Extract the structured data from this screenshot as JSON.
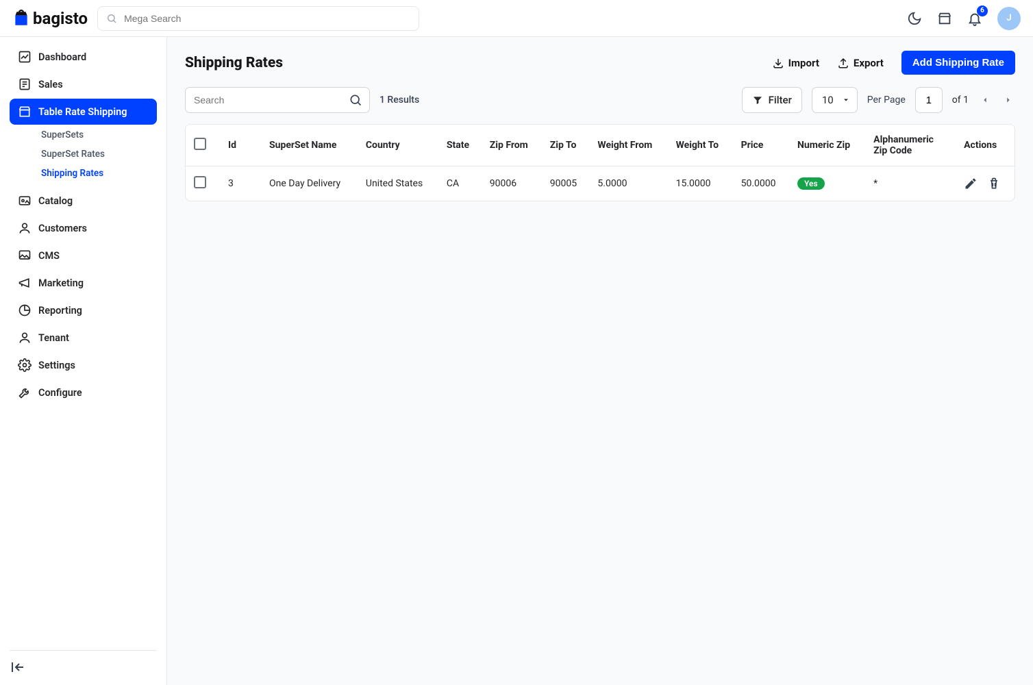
{
  "brand": "bagisto",
  "search": {
    "placeholder": "Mega Search"
  },
  "notifications": {
    "count": "6"
  },
  "avatar": {
    "initial": "J"
  },
  "nav": {
    "dashboard": "Dashboard",
    "sales": "Sales",
    "table_rate": "Table Rate Shipping",
    "sub": {
      "supersets": "SuperSets",
      "superset_rates": "SuperSet Rates",
      "shipping_rates": "Shipping Rates"
    },
    "catalog": "Catalog",
    "customers": "Customers",
    "cms": "CMS",
    "marketing": "Marketing",
    "reporting": "Reporting",
    "tenant": "Tenant",
    "settings": "Settings",
    "configure": "Configure"
  },
  "page": {
    "title": "Shipping Rates",
    "import": "Import",
    "export": "Export",
    "add": "Add Shipping Rate"
  },
  "toolbar": {
    "search_placeholder": "Search",
    "results": "1 Results",
    "filter": "Filter",
    "per_page_value": "10",
    "per_page_label": "Per Page",
    "page": "1",
    "of": "of 1"
  },
  "cols": {
    "id": "Id",
    "superset": "SuperSet Name",
    "country": "Country",
    "state": "State",
    "zip_from": "Zip From",
    "zip_to": "Zip To",
    "weight_from": "Weight From",
    "weight_to": "Weight To",
    "price": "Price",
    "numeric_zip": "Numeric Zip",
    "alpha_zip": "Alphanumeric Zip Code",
    "actions": "Actions"
  },
  "rows": [
    {
      "id": "3",
      "superset": "One Day Delivery",
      "country": "United States",
      "state": "CA",
      "zip_from": "90006",
      "zip_to": "90005",
      "weight_from": "5.0000",
      "weight_to": "15.0000",
      "price": "50.0000",
      "numeric_zip": "Yes",
      "alpha_zip": "*"
    }
  ]
}
